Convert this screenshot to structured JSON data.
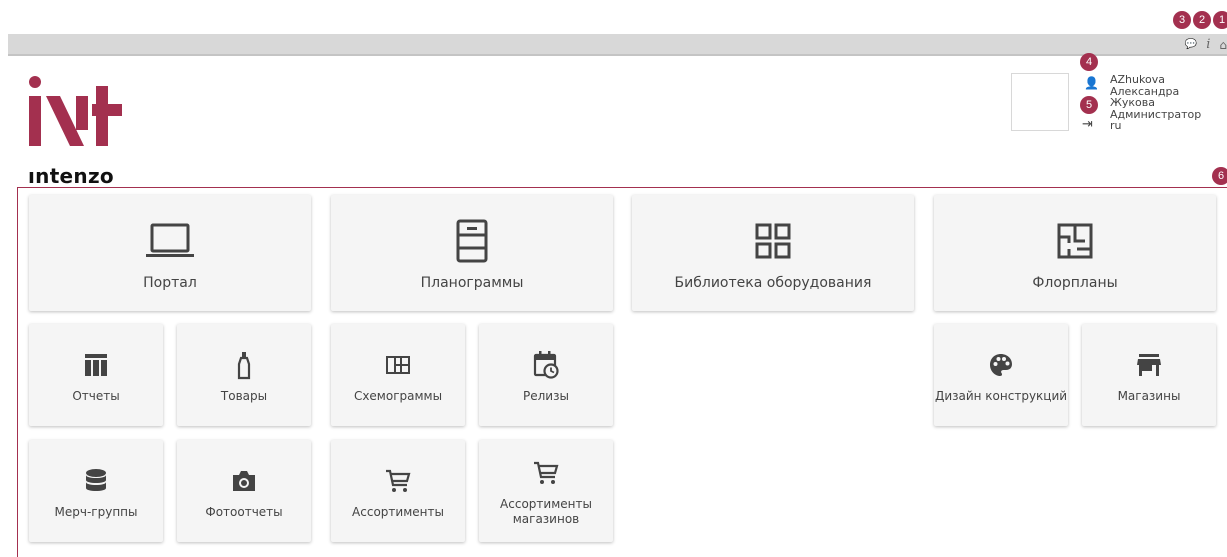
{
  "badges": {
    "b1": "1",
    "b2": "2",
    "b3": "3",
    "b4": "4",
    "b5": "5",
    "b6": "6"
  },
  "topbar": {
    "comment_glyph": "💬",
    "info_glyph": "i",
    "home_glyph": "⌂"
  },
  "logo": {
    "text": "ıntenzo",
    "brand_color": "#a3304f"
  },
  "user": {
    "login": "AZhukova",
    "first_name": "Александра",
    "last_name": "Жукова",
    "role": "Администратор",
    "locale": "ru",
    "person_glyph": "👤",
    "logout_glyph": "⇥"
  },
  "tiles": {
    "portal": {
      "label": "Портал",
      "icon": "laptop-icon"
    },
    "planograms": {
      "label": "Планограммы",
      "icon": "shelf-icon"
    },
    "equipment": {
      "label": "Библиотека оборудования",
      "icon": "grid-view-icon"
    },
    "floorplans": {
      "label": "Флорпланы",
      "icon": "floorplan-icon"
    },
    "reports": {
      "label": "Отчеты",
      "icon": "table-chart-icon"
    },
    "products": {
      "label": "Товары",
      "icon": "bottle-icon"
    },
    "schemograms": {
      "label": "Схемограммы",
      "icon": "grid-layout-icon"
    },
    "releases": {
      "label": "Релизы",
      "icon": "calendar-clock-icon"
    },
    "design": {
      "label": "Дизайн конструкций",
      "icon": "palette-icon"
    },
    "stores": {
      "label": "Магазины",
      "icon": "store-icon"
    },
    "merch_groups": {
      "label": "Мерч-группы",
      "icon": "database-icon"
    },
    "photo_reports": {
      "label": "Фотоотчеты",
      "icon": "camera-icon"
    },
    "assortments": {
      "label": "Ассортименты",
      "icon": "cart-icon"
    },
    "store_assortments": {
      "label": "Ассортименты магазинов",
      "icon": "cart-icon"
    }
  },
  "colors": {
    "accent": "#a3304f",
    "tile_bg": "#f5f5f5",
    "icon": "#444444"
  }
}
